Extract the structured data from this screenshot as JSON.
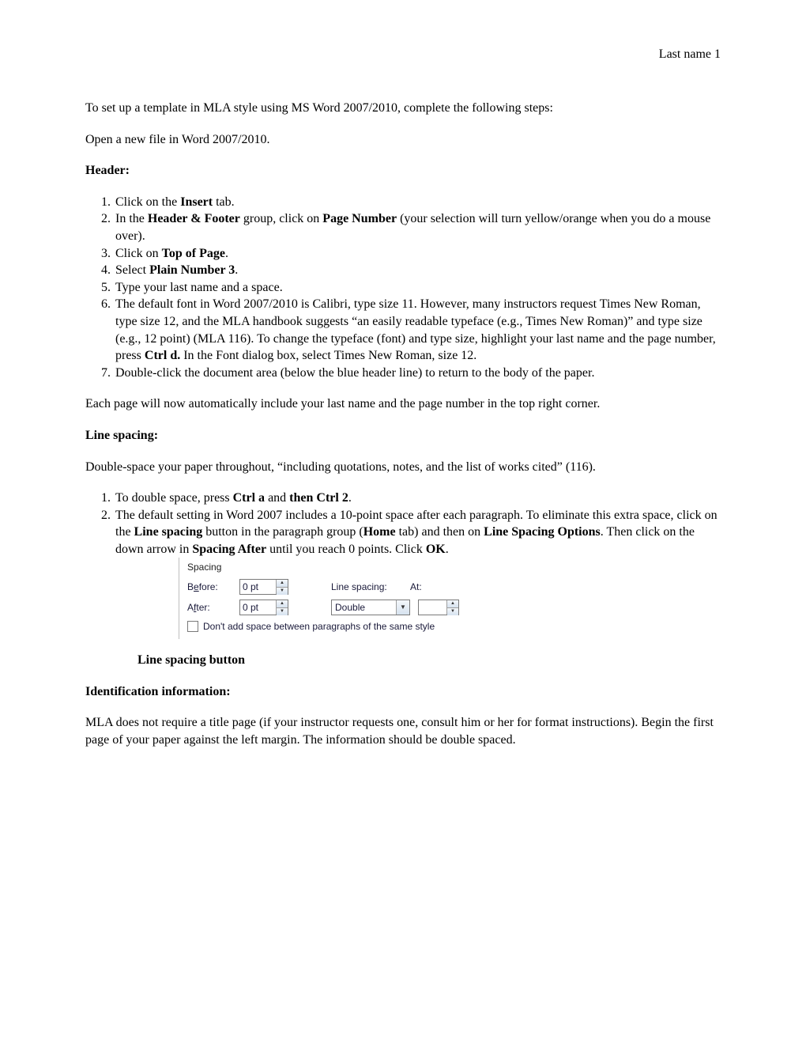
{
  "header_right": "Last name 1",
  "intro": "To set up a template in MLA style using MS Word 2007/2010, complete the following steps:",
  "open_file": "Open a new file in Word 2007/2010.",
  "heading_header": "Header:",
  "header_list": {
    "i1_pre": "Click on the ",
    "i1_b1": "Insert",
    "i1_post": " tab.",
    "i2_pre": "In the ",
    "i2_b1": "Header & Footer",
    "i2_mid": " group, click on ",
    "i2_b2": "Page Number",
    "i2_post": " (your selection will turn yellow/orange when you do a mouse over).",
    "i3_pre": "Click on ",
    "i3_b1": "Top of Page",
    "i3_post": ".",
    "i4_pre": "Select ",
    "i4_b1": "Plain Number 3",
    "i4_post": ".",
    "i5": "Type your last name and a space.",
    "i6_pre": "The default font in Word 2007/2010 is Calibri, type size 11.  However, many instructors request Times New Roman, type size 12, and the MLA handbook suggests “an easily readable typeface (e.g., Times New Roman)” and type size (e.g., 12 point) (MLA 116).  To change the typeface (font) and type size, highlight your last name and the page number, press ",
    "i6_b1": "Ctrl d.",
    "i6_post": "   In the Font dialog box, select Times New Roman, size 12.",
    "i7": "Double-click the document area (below the blue header line) to return to the body of the paper."
  },
  "after_header": "Each page will now automatically include your last name and the page number in the top right corner.",
  "heading_linespacing": "Line spacing:",
  "linespacing_intro": "Double-space your paper throughout, “including quotations, notes, and the list of works cited” (116).",
  "ls_list": {
    "i1_pre": "To double space, press ",
    "i1_b1": "Ctrl a",
    "i1_mid": " and ",
    "i1_b2": "then Ctrl 2",
    "i1_post": ".",
    "i2_pre": "The default setting in Word 2007 includes a 10-point space after each paragraph.  To eliminate this extra space, click on the ",
    "i2_b1": "Line spacing",
    "i2_mid1": " button in the paragraph group (",
    "i2_b2": "Home",
    "i2_mid2": " tab) and then on ",
    "i2_b3": "Line Spacing Options",
    "i2_mid3": ".  Then click on the down arrow in ",
    "i2_b4": "Spacing After",
    "i2_mid4": " until you reach 0 points.  Click ",
    "i2_b5": "OK",
    "i2_post": "."
  },
  "panel": {
    "title": "Spacing",
    "before_lbl_pre": "B",
    "before_lbl_ul": "e",
    "before_lbl_post": "fore:",
    "before_val": "0 pt",
    "after_lbl_pre": "A",
    "after_lbl_ul": "f",
    "after_lbl_post": "ter:",
    "after_val": "0 pt",
    "lns_lbl_pre": "Li",
    "lns_lbl_ul": "n",
    "lns_lbl_post": "e spacing:",
    "lns_val": "Double",
    "at_lbl_pre": "",
    "at_lbl_ul": "A",
    "at_lbl_post": "t:",
    "at_val": "",
    "check_lbl": "Don't add space between paragraphs of the same style"
  },
  "caption": "Line spacing button",
  "heading_ident": "Identification information:",
  "ident_para": "MLA does not require a title page (if your instructor requests one, consult him or her for format instructions).  Begin the first page of your paper against the left margin. The information should be double spaced."
}
